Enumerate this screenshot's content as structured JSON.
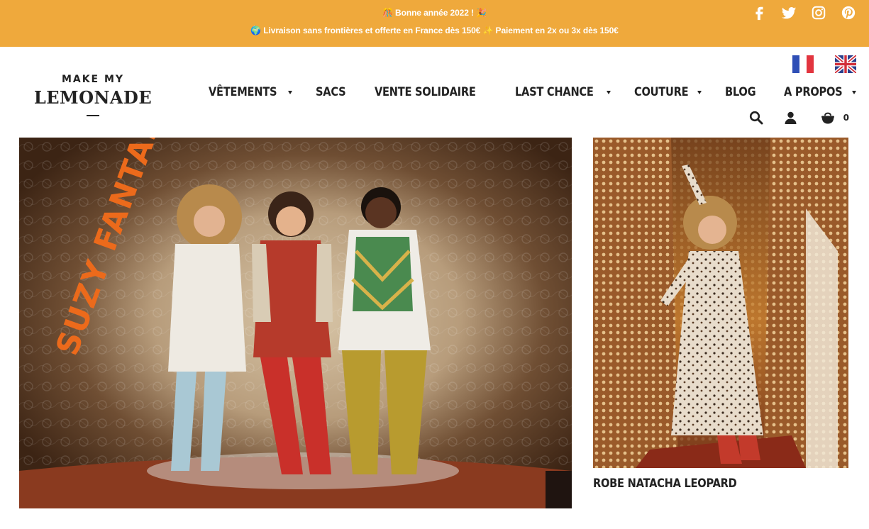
{
  "announcement": {
    "line1": "🎊 Bonne année 2022 ! 🎉",
    "line2": "🌍 Livraison sans frontières et offerte en France dès 150€ ✨  Paiement en 2x ou 3x dès 150€",
    "color": "#efa93c"
  },
  "social": [
    "facebook-icon",
    "twitter-icon",
    "instagram-icon",
    "pinterest-icon"
  ],
  "logo": {
    "top": "MAKE MY",
    "main": "LEMONADE"
  },
  "languages": [
    "french-flag-icon",
    "uk-flag-icon"
  ],
  "nav": {
    "items": [
      {
        "label": "VÊTEMENTS",
        "dropdown": true
      },
      {
        "label": "SACS",
        "dropdown": false
      },
      {
        "label": "VENTE SOLIDAIRE",
        "dropdown": false
      },
      {
        "label": "LAST CHANCE",
        "dropdown": true
      },
      {
        "label": "COUTURE",
        "dropdown": true
      },
      {
        "label": "BLOG",
        "dropdown": false
      },
      {
        "label": "A PROPOS",
        "dropdown": true
      }
    ]
  },
  "tools": {
    "cart_count": "0"
  },
  "hero": {
    "artwork_text": "SUZY FANTASY"
  },
  "product": {
    "title": "ROBE NATACHA LEOPARD"
  }
}
